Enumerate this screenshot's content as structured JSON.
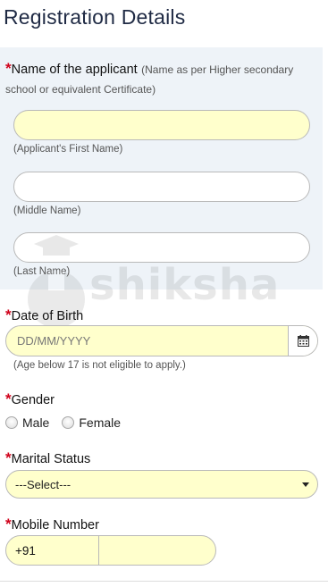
{
  "page": {
    "title": "Registration Details"
  },
  "applicant_name": {
    "required_mark": "*",
    "label": "Name of the applicant",
    "note": "(Name as per Higher secondary school or equivalent Certificate)",
    "first_hint": "(Applicant's First Name)",
    "middle_hint": "(Middle Name)",
    "last_hint": "(Last Name)",
    "first_value": "",
    "middle_value": "",
    "last_value": ""
  },
  "dob": {
    "required_mark": "*",
    "label": "Date of Birth",
    "placeholder": "DD/MM/YYYY",
    "hint": "(Age below 17 is not eligible to apply.)",
    "icon": "calendar-icon"
  },
  "gender": {
    "required_mark": "*",
    "label": "Gender",
    "options": [
      "Male",
      "Female"
    ]
  },
  "marital_status": {
    "required_mark": "*",
    "label": "Marital Status",
    "selected": "---Select---",
    "icon": "caret-down-icon"
  },
  "mobile": {
    "required_mark": "*",
    "label": "Mobile Number",
    "country_code": "+91",
    "value": ""
  },
  "watermark": {
    "text": "shiksha"
  },
  "colors": {
    "title": "#1f2a44",
    "required": "#d0021b",
    "highlight_field": "#ffffcc",
    "name_block_bg": "#eef3f8"
  }
}
